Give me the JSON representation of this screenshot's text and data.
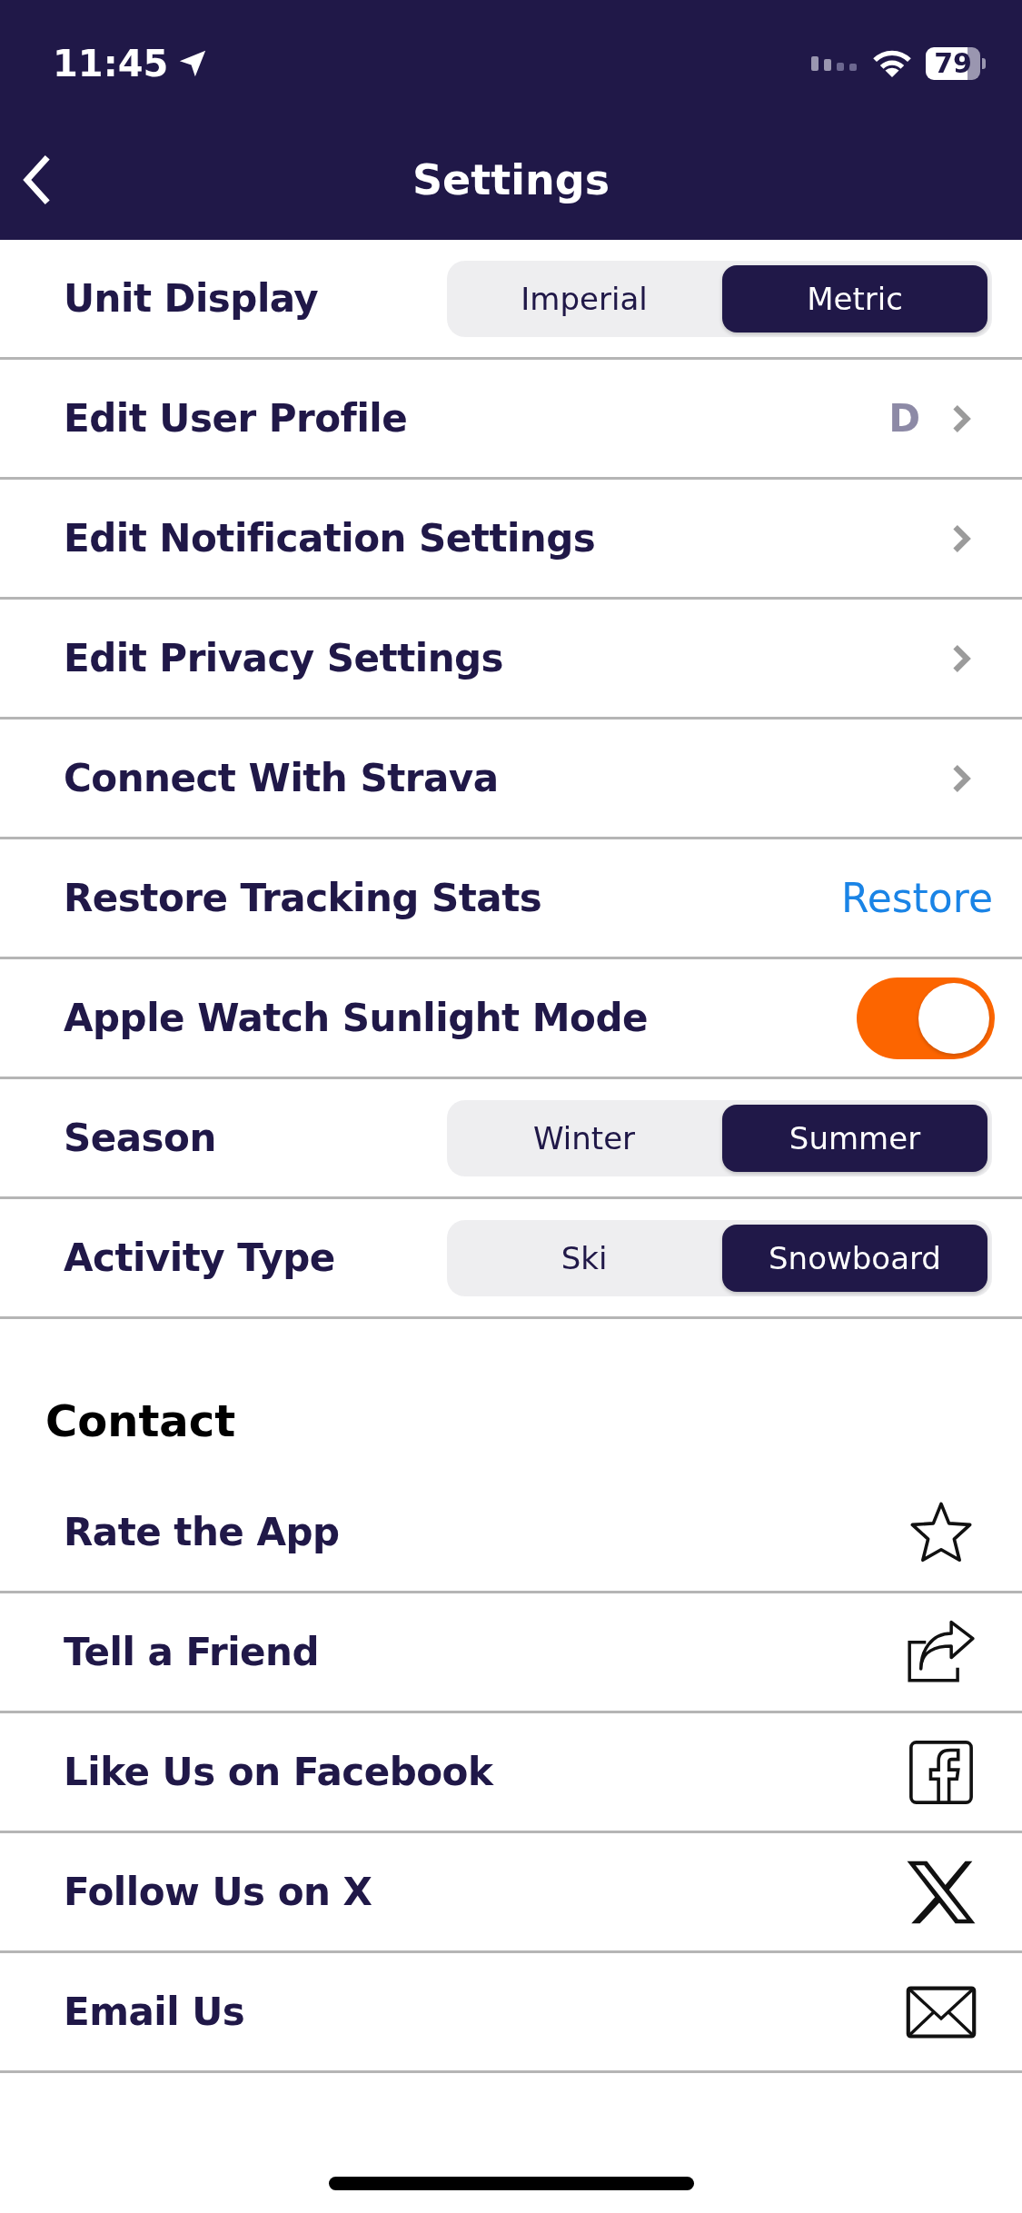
{
  "status_bar": {
    "time": "11:45",
    "battery": "79"
  },
  "nav": {
    "title": "Settings"
  },
  "settings": [
    {
      "kind": "segmented",
      "label": "Unit Display",
      "options": [
        {
          "label": "Imperial",
          "selected": false
        },
        {
          "label": "Metric",
          "selected": true
        }
      ]
    },
    {
      "kind": "link",
      "label": "Edit User Profile",
      "value": "D"
    },
    {
      "kind": "link",
      "label": "Edit Notification Settings"
    },
    {
      "kind": "link",
      "label": "Edit Privacy Settings"
    },
    {
      "kind": "link",
      "label": "Connect With Strava"
    },
    {
      "kind": "action",
      "label": "Restore Tracking Stats",
      "action": "Restore"
    },
    {
      "kind": "toggle",
      "label": "Apple Watch Sunlight Mode",
      "on": true
    },
    {
      "kind": "segmented",
      "label": "Season",
      "options": [
        {
          "label": "Winter",
          "selected": false
        },
        {
          "label": "Summer",
          "selected": true
        }
      ]
    },
    {
      "kind": "segmented",
      "label": "Activity Type",
      "options": [
        {
          "label": "Ski",
          "selected": false
        },
        {
          "label": "Snowboard",
          "selected": true
        }
      ]
    }
  ],
  "contact": {
    "title": "Contact",
    "items": [
      "Rate the App",
      "Tell a Friend",
      "Like Us on Facebook",
      "Follow Us on X",
      "Email Us"
    ]
  }
}
